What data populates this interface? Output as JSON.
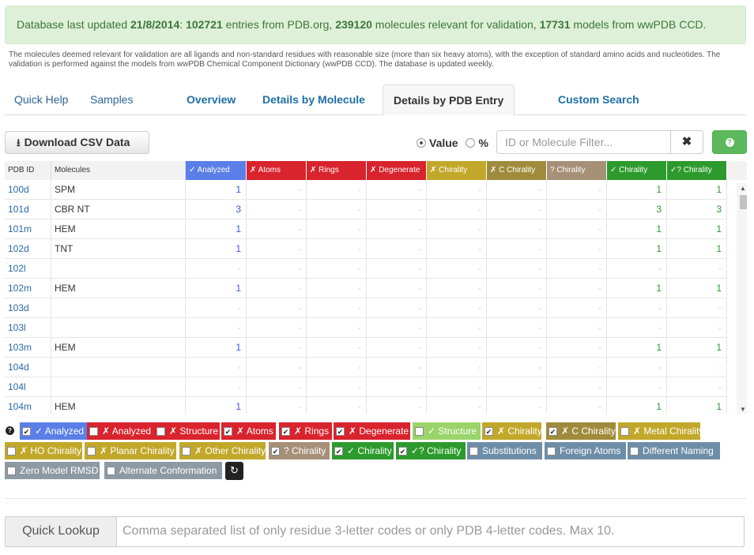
{
  "banner": {
    "prefix": "Database last updated ",
    "date": "21/8/2014",
    "colon": ": ",
    "entries": "102721",
    "entries_text": " entries from PDB.org, ",
    "molecules": "239120",
    "molecules_text": " molecules relevant for validation, ",
    "models": "17731",
    "models_text": " models from wwPDB CCD."
  },
  "note": "The molecules deemed relevant for validation are all ligands and non-standard residues with reasonable size (more than six heavy atoms), with the exception of standard amino acids and nucleotides. The validation is performed against the models from wwPDB Chemical Component Dictionary (wwPDB CCD). The database is updated weekly.",
  "tabs": {
    "quick_help": "Quick Help",
    "samples": "Samples",
    "overview": "Overview",
    "by_molecule": "Details by Molecule",
    "by_pdb": "Details by PDB Entry",
    "custom_search": "Custom Search"
  },
  "toolbar": {
    "download_label": "Download CSV Data",
    "download_icon": "download-icon",
    "radio_value": "Value",
    "radio_percent": "%",
    "filter_placeholder": "ID or Molecule Filter...",
    "clear_icon": "✖",
    "help_icon": "?"
  },
  "table": {
    "headers": [
      "PDB ID",
      "Molecules",
      "✓ Analyzed",
      "✗ Atoms",
      "✗ Rings",
      "✗ Degenerate",
      "✗ Chirality",
      "✗ C Chirality",
      "? Chirality",
      "✓ Chirality",
      "✓? Chirality"
    ],
    "header_colors": [
      "",
      "",
      "#5b7fe8",
      "#d9232d",
      "#d9232d",
      "#d9232d",
      "#c2a82a",
      "#a08b3c",
      "#a69077",
      "#2c9a2c",
      "#2c9a2c"
    ],
    "rows": [
      [
        "100d",
        "SPM",
        "1",
        "-",
        "-",
        "-",
        "-",
        "-",
        "-",
        "1",
        "1"
      ],
      [
        "101d",
        "CBR NT",
        "3",
        "-",
        "-",
        "-",
        "-",
        "-",
        "-",
        "3",
        "3"
      ],
      [
        "101m",
        "HEM",
        "1",
        "-",
        "-",
        "-",
        "-",
        "-",
        "-",
        "1",
        "1"
      ],
      [
        "102d",
        "TNT",
        "1",
        "-",
        "-",
        "-",
        "-",
        "-",
        "-",
        "1",
        "1"
      ],
      [
        "102l",
        "",
        "-",
        "-",
        "-",
        "-",
        "-",
        "-",
        "-",
        "-",
        "-"
      ],
      [
        "102m",
        "HEM",
        "1",
        "-",
        "-",
        "-",
        "-",
        "-",
        "-",
        "1",
        "1"
      ],
      [
        "103d",
        "",
        "-",
        "-",
        "-",
        "-",
        "-",
        "-",
        "-",
        "-",
        "-"
      ],
      [
        "103l",
        "",
        "-",
        "-",
        "-",
        "-",
        "-",
        "-",
        "-",
        "-",
        "-"
      ],
      [
        "103m",
        "HEM",
        "1",
        "-",
        "-",
        "-",
        "-",
        "-",
        "-",
        "1",
        "1"
      ],
      [
        "104d",
        "",
        "-",
        "-",
        "-",
        "-",
        "-",
        "-",
        "-",
        "-",
        "-"
      ],
      [
        "104l",
        "",
        "-",
        "-",
        "-",
        "-",
        "-",
        "-",
        "-",
        "-",
        "-"
      ],
      [
        "104m",
        "HEM",
        "1",
        "-",
        "-",
        "-",
        "-",
        "-",
        "-",
        "1",
        "1"
      ]
    ]
  },
  "toggles": [
    {
      "label": "✓ Analyzed",
      "checked": true,
      "color": "#5b7fe8"
    },
    {
      "label": "✗ Analyzed",
      "checked": false,
      "color": "#d9232d"
    },
    {
      "label": "✗ Structure",
      "checked": false,
      "color": "#d9232d"
    },
    {
      "label": "✗ Atoms",
      "checked": true,
      "color": "#d9232d"
    },
    {
      "label": "✗ Rings",
      "checked": true,
      "color": "#d9232d"
    },
    {
      "label": "✗ Degenerate",
      "checked": true,
      "color": "#d9232d"
    },
    {
      "label": "✓ Structure",
      "checked": false,
      "color": "#9ad46a"
    },
    {
      "label": "✗ Chirality",
      "checked": true,
      "color": "#c2a82a"
    },
    {
      "label": "✗ C Chirality",
      "checked": true,
      "color": "#a08b3c"
    },
    {
      "label": "✗ Metal Chirality",
      "checked": false,
      "color": "#c2a82a"
    },
    {
      "label": "✗ HO Chirality",
      "checked": false,
      "color": "#c2a82a"
    },
    {
      "label": "✗ Planar Chirality",
      "checked": false,
      "color": "#c2a82a"
    },
    {
      "label": "✗ Other Chirality",
      "checked": false,
      "color": "#c2a82a"
    },
    {
      "label": "? Chirality",
      "checked": true,
      "color": "#a69077"
    },
    {
      "label": "✓ Chirality",
      "checked": true,
      "color": "#2c9a2c"
    },
    {
      "label": "✓? Chirality",
      "checked": true,
      "color": "#2c9a2c"
    },
    {
      "label": "Substitutions",
      "checked": false,
      "color": "#6e8ea8"
    },
    {
      "label": "Foreign Atoms",
      "checked": false,
      "color": "#6e8ea8"
    },
    {
      "label": "Different Naming",
      "checked": false,
      "color": "#6e8ea8"
    },
    {
      "label": "Zero Model RMSD",
      "checked": false,
      "color": "#8e9aa3"
    },
    {
      "label": "Alternate Conformation",
      "checked": false,
      "color": "#8e9aa3"
    }
  ],
  "refresh_icon": "↻",
  "lookup": {
    "label": "Quick Lookup",
    "placeholder": "Comma separated list of only residue 3-letter codes or only PDB 4-letter codes. Max 10."
  }
}
